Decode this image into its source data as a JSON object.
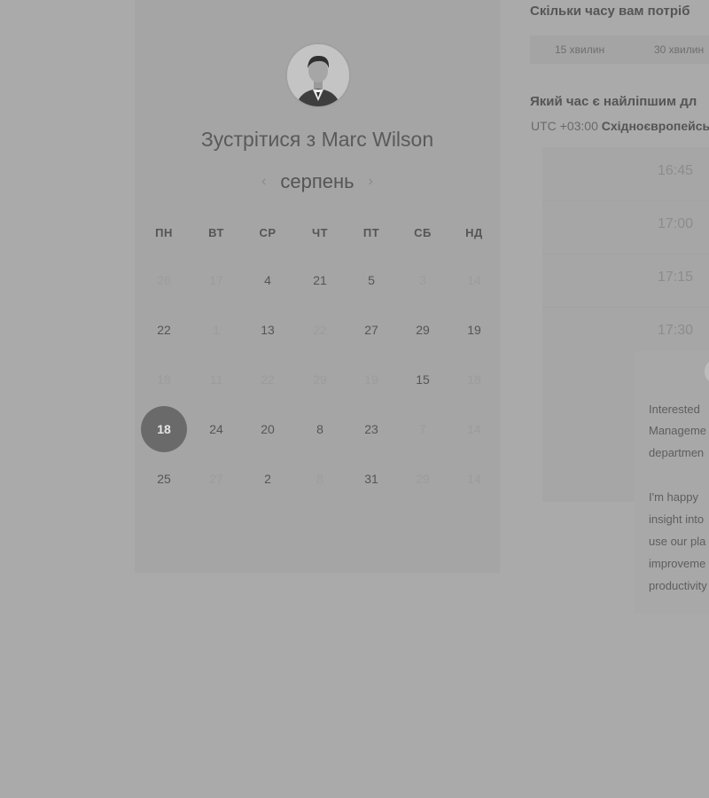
{
  "booking": {
    "title": "Зустрітися з Marc Wilson",
    "month": "серпень",
    "weekdays": [
      "ПН",
      "ВТ",
      "СР",
      "ЧТ",
      "ПТ",
      "СБ",
      "НД"
    ],
    "weeks": [
      [
        "26",
        "17",
        "4",
        "21",
        "5",
        "3",
        "14"
      ],
      [
        "22",
        "1",
        "13",
        "22",
        "27",
        "29",
        "19"
      ],
      [
        "18",
        "11",
        "22",
        "29",
        "19",
        "15",
        "18"
      ],
      [
        "18",
        "24",
        "20",
        "8",
        "23",
        "7",
        "14"
      ],
      [
        "25",
        "27",
        "2",
        "8",
        "31",
        "29",
        "14"
      ]
    ],
    "muted_cells": [
      "0-0",
      "0-1",
      "0-5",
      "0-6",
      "1-1",
      "1-3",
      "2-0",
      "2-1",
      "2-2",
      "2-3",
      "2-4",
      "2-6",
      "3-5",
      "3-6",
      "4-1",
      "4-3",
      "4-5",
      "4-6"
    ],
    "selected_cell": "3-0"
  },
  "right": {
    "duration_question": "Скільки часу вам потріб",
    "durations": [
      "15 хвилин",
      "30 хвилин"
    ],
    "time_question": "Який час є найліпшим дл",
    "timezone_offset": "UTC +03:00",
    "timezone_name": "Східноєвропейсь",
    "slots": [
      "16:45",
      "17:00",
      "17:15",
      "17:30"
    ],
    "description_lines": [
      "Interested",
      "Manageme",
      "departmen",
      "I'm happy",
      "insight into",
      "use our pla",
      "improveme",
      "productivity"
    ]
  }
}
